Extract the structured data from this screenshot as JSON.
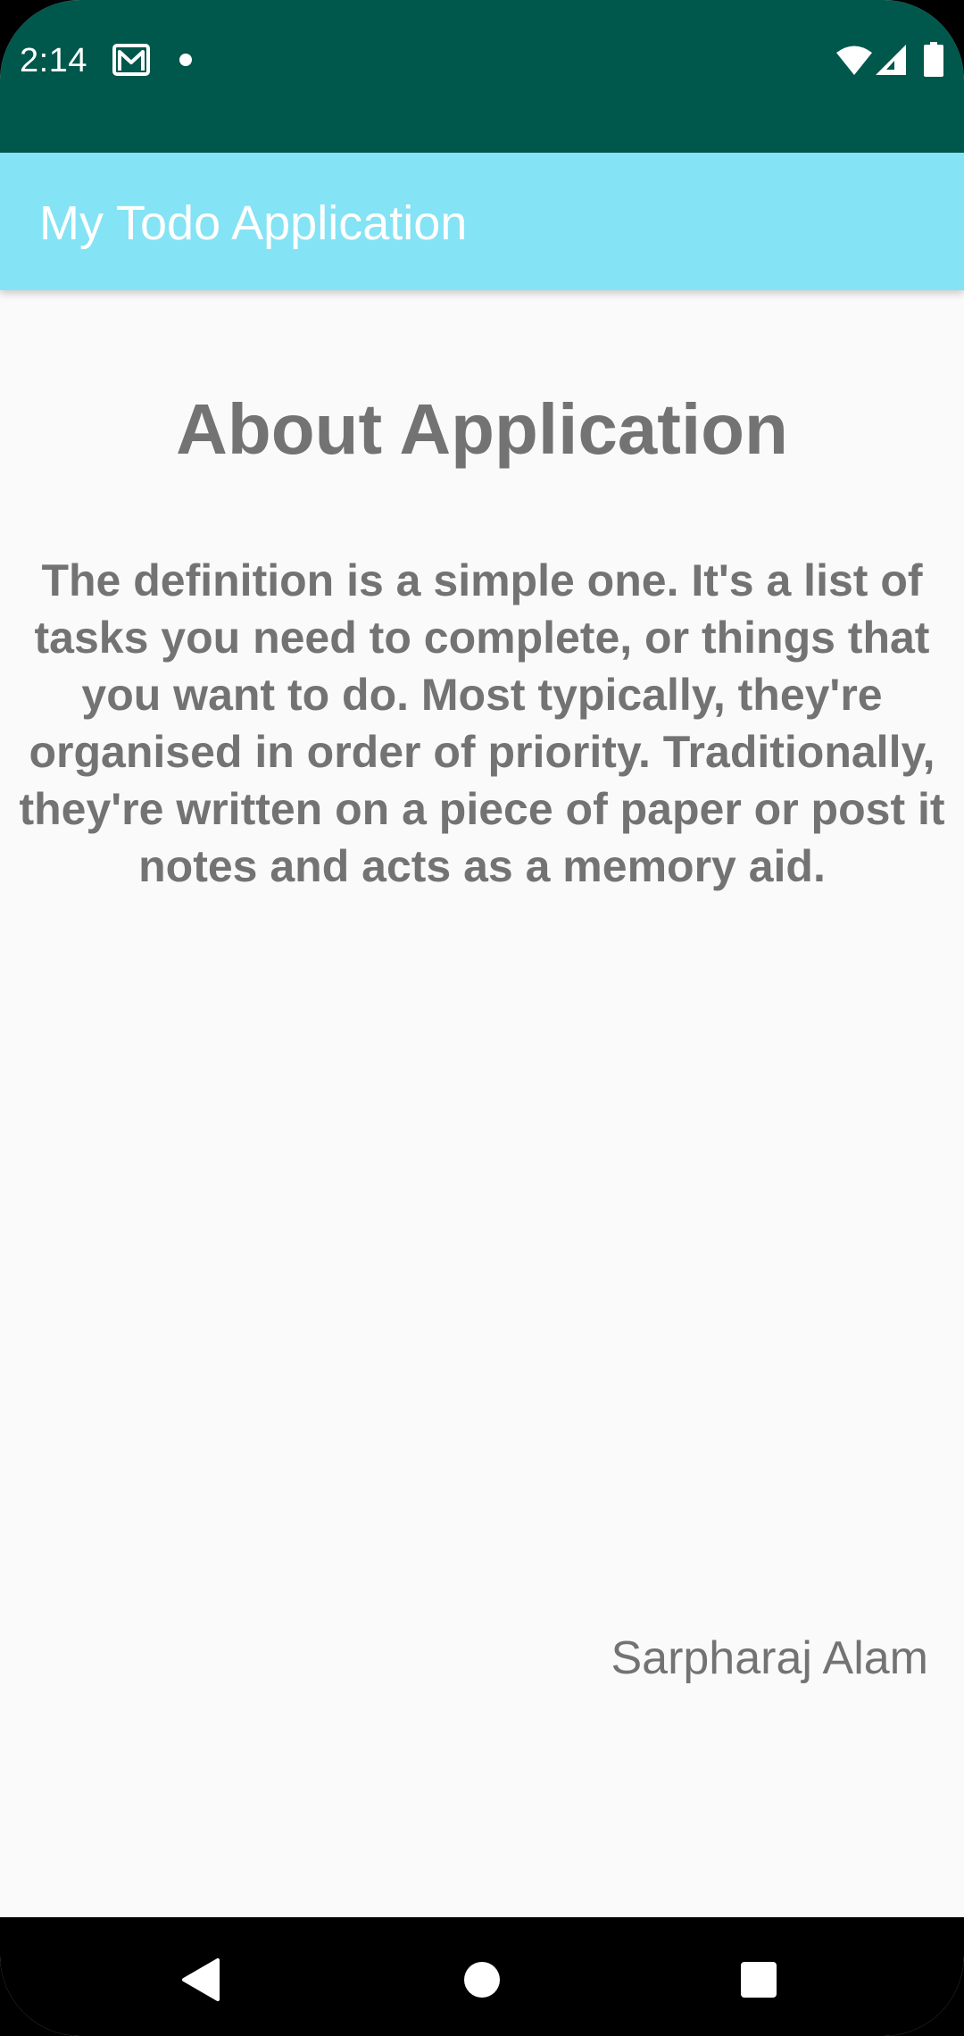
{
  "status_bar": {
    "time": "2:14",
    "icons": [
      "gmail-icon",
      "notification-dot-icon",
      "wifi-icon",
      "signal-icon",
      "battery-icon"
    ],
    "background_color": "#00574b"
  },
  "app_bar": {
    "title": "My Todo Application",
    "background_color": "#84e3f4"
  },
  "content": {
    "heading": "About Application",
    "body": "The definition is a simple one. It's a list of tasks you need to complete, or things that you want to do. Most typically, they're organised in order of priority. Traditionally, they're written on a piece of paper or post it notes and acts as a memory aid.",
    "author": "Sarpharaj Alam",
    "text_color": "#737373"
  },
  "nav_bar": {
    "buttons": [
      "back-icon",
      "home-icon",
      "recents-icon"
    ]
  }
}
